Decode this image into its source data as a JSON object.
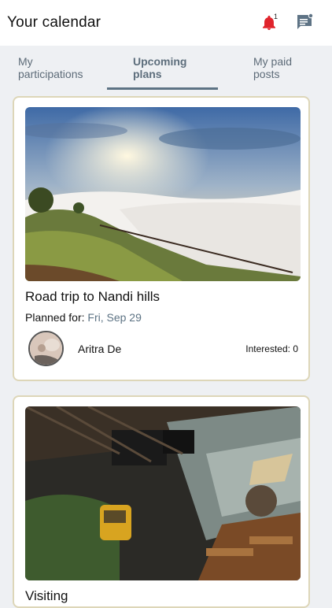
{
  "header": {
    "title": "Your calendar",
    "notification_count": "1",
    "bell_color": "#e0242c",
    "chat_color": "#5e7385"
  },
  "tabs": [
    {
      "label": "My participations",
      "line1": "My",
      "line2": "participations",
      "active": false
    },
    {
      "label": "Upcoming plans",
      "line1": "Upcoming",
      "line2": "plans",
      "active": true
    },
    {
      "label": "My paid posts",
      "line1": "My paid",
      "line2": "posts",
      "active": false
    }
  ],
  "plans": [
    {
      "title": "Road trip to Nandi hills",
      "planned_label": "Planned for:",
      "date": "Fri, Sep 29",
      "host": "Aritra De",
      "interested": "Interested: 0"
    },
    {
      "title": "Visiting ",
      "planned_label": "",
      "date": "",
      "host": "",
      "interested": ""
    }
  ],
  "colors": {
    "accent": "#5d7384",
    "card_border": "#ddd6b8",
    "background": "#eef0f3"
  }
}
